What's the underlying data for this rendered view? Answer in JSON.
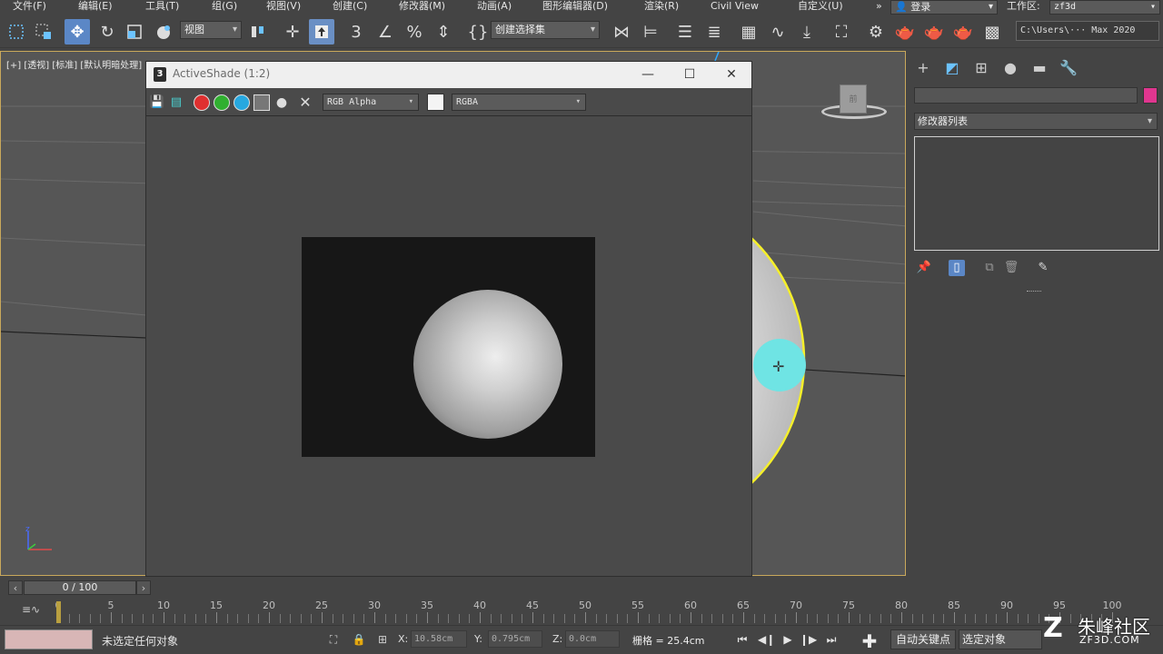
{
  "menubar": {
    "items": [
      "文件(F)",
      "编辑(E)",
      "工具(T)",
      "组(G)",
      "视图(V)",
      "创建(C)",
      "修改器(M)",
      "动画(A)",
      "图形编辑器(D)",
      "渲染(R)",
      "Civil View",
      "自定义(U)"
    ],
    "overflow": "»",
    "login_label": "登录",
    "workspace_label": "工作区:",
    "workspace_value": "zf3d"
  },
  "toolbar": {
    "view_dropdown": "视图",
    "selection_set_dropdown": "创建选择集",
    "project_path": "C:\\Users\\··· Max 2020"
  },
  "viewport": {
    "label": "[+] [透视] [标准] [默认明暗处理]"
  },
  "activeshade": {
    "title": "ActiveShade (1:2)",
    "logo": "3",
    "channel_display": "RGB Alpha",
    "display_mode": "RGBA"
  },
  "command_panel": {
    "modifier_list": "修改器列表",
    "object_color": "#e0368f"
  },
  "timeline": {
    "frame_display": "0 / 100",
    "tick_labels": [
      "0",
      "5",
      "10",
      "15",
      "20",
      "25",
      "30",
      "35",
      "40",
      "45",
      "50",
      "55",
      "60",
      "65",
      "70",
      "75",
      "80",
      "85",
      "90",
      "95",
      "100"
    ],
    "current_frame": 0
  },
  "statusbar": {
    "status_text": "未选定任何对象",
    "x_label": "X:",
    "x_value": "10.58cm",
    "y_label": "Y:",
    "y_value": "0.795cm",
    "z_label": "Z:",
    "z_value": "0.0cm",
    "grid_text": "栅格 = 25.4cm",
    "autokey_label": "自动关键点",
    "selected_object_label": "选定对象"
  },
  "watermark": {
    "logo": "Z",
    "main": "朱峰社区",
    "sub": "ZF3D.COM"
  }
}
